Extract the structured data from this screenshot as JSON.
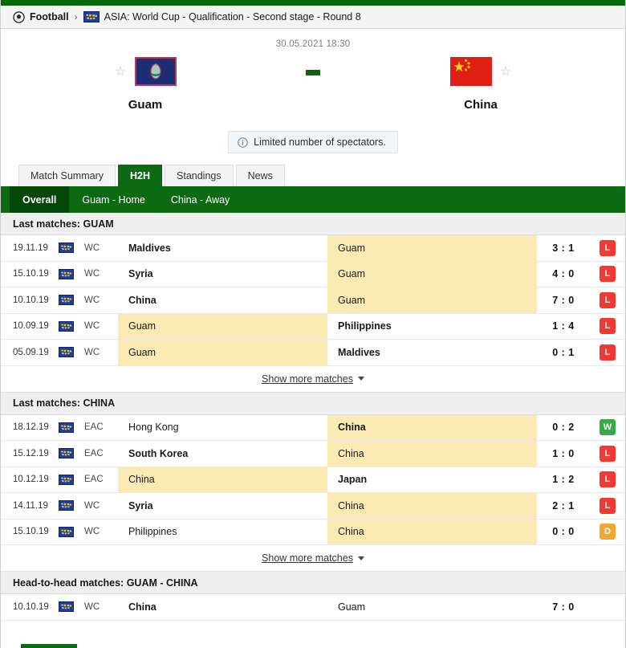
{
  "breadcrumb": {
    "sport": "Football",
    "separator": "›",
    "league": "ASIA: World Cup - Qualification - Second stage - Round 8",
    "sport_icon": "football-icon",
    "league_icon": "world-cup-flag-icon"
  },
  "match": {
    "kickoff": "30.05.2021 18:30",
    "home_team": "Guam",
    "away_team": "China",
    "score_placeholder": "-",
    "notice": "Limited number of spectators.",
    "notice_icon": "info-icon",
    "home_star_icon": "star-outline-icon",
    "away_star_icon": "star-outline-icon"
  },
  "tabs": [
    {
      "label": "Match Summary",
      "active": false
    },
    {
      "label": "H2H",
      "active": true
    },
    {
      "label": "Standings",
      "active": false
    },
    {
      "label": "News",
      "active": false
    }
  ],
  "subtabs": [
    {
      "label": "Overall",
      "active": true
    },
    {
      "label": "Guam - Home",
      "active": false
    },
    {
      "label": "China - Away",
      "active": false
    }
  ],
  "sections": [
    {
      "title": "Last matches: GUAM",
      "show_more": "Show more matches",
      "rows": [
        {
          "date": "19.11.19",
          "comp": "WC",
          "home": "Maldives",
          "away": "Guam",
          "home_bold": true,
          "away_bold": false,
          "home_hl": false,
          "away_hl": true,
          "score": "3 : 1",
          "result": "L"
        },
        {
          "date": "15.10.19",
          "comp": "WC",
          "home": "Syria",
          "away": "Guam",
          "home_bold": true,
          "away_bold": false,
          "home_hl": false,
          "away_hl": true,
          "score": "4 : 0",
          "result": "L"
        },
        {
          "date": "10.10.19",
          "comp": "WC",
          "home": "China",
          "away": "Guam",
          "home_bold": true,
          "away_bold": false,
          "home_hl": false,
          "away_hl": true,
          "score": "7 : 0",
          "result": "L"
        },
        {
          "date": "10.09.19",
          "comp": "WC",
          "home": "Guam",
          "away": "Philippines",
          "home_bold": false,
          "away_bold": true,
          "home_hl": true,
          "away_hl": false,
          "score": "1 : 4",
          "result": "L"
        },
        {
          "date": "05.09.19",
          "comp": "WC",
          "home": "Guam",
          "away": "Maldives",
          "home_bold": false,
          "away_bold": true,
          "home_hl": true,
          "away_hl": false,
          "score": "0 : 1",
          "result": "L"
        }
      ]
    },
    {
      "title": "Last matches: CHINA",
      "show_more": "Show more matches",
      "rows": [
        {
          "date": "18.12.19",
          "comp": "EAC",
          "home": "Hong Kong",
          "away": "China",
          "home_bold": false,
          "away_bold": true,
          "home_hl": false,
          "away_hl": true,
          "score": "0 : 2",
          "result": "W"
        },
        {
          "date": "15.12.19",
          "comp": "EAC",
          "home": "South Korea",
          "away": "China",
          "home_bold": true,
          "away_bold": false,
          "home_hl": false,
          "away_hl": true,
          "score": "1 : 0",
          "result": "L"
        },
        {
          "date": "10.12.19",
          "comp": "EAC",
          "home": "China",
          "away": "Japan",
          "home_bold": false,
          "away_bold": true,
          "home_hl": true,
          "away_hl": false,
          "score": "1 : 2",
          "result": "L"
        },
        {
          "date": "14.11.19",
          "comp": "WC",
          "home": "Syria",
          "away": "China",
          "home_bold": true,
          "away_bold": false,
          "home_hl": false,
          "away_hl": true,
          "score": "2 : 1",
          "result": "L"
        },
        {
          "date": "15.10.19",
          "comp": "WC",
          "home": "Philippines",
          "away": "China",
          "home_bold": false,
          "away_bold": false,
          "home_hl": false,
          "away_hl": true,
          "score": "0 : 0",
          "result": "D"
        }
      ]
    },
    {
      "title": "Head-to-head matches: GUAM - CHINA",
      "show_more": null,
      "rows": [
        {
          "date": "10.10.19",
          "comp": "WC",
          "home": "China",
          "away": "Guam",
          "home_bold": true,
          "away_bold": false,
          "home_hl": false,
          "away_hl": false,
          "score": "7 : 0",
          "result": null
        }
      ]
    }
  ],
  "colors": {
    "brand_green": "#0c6b12",
    "win": "#35aa47",
    "loss": "#ee3a32",
    "draw": "#f0a830",
    "highlight": "#fbeab4"
  }
}
